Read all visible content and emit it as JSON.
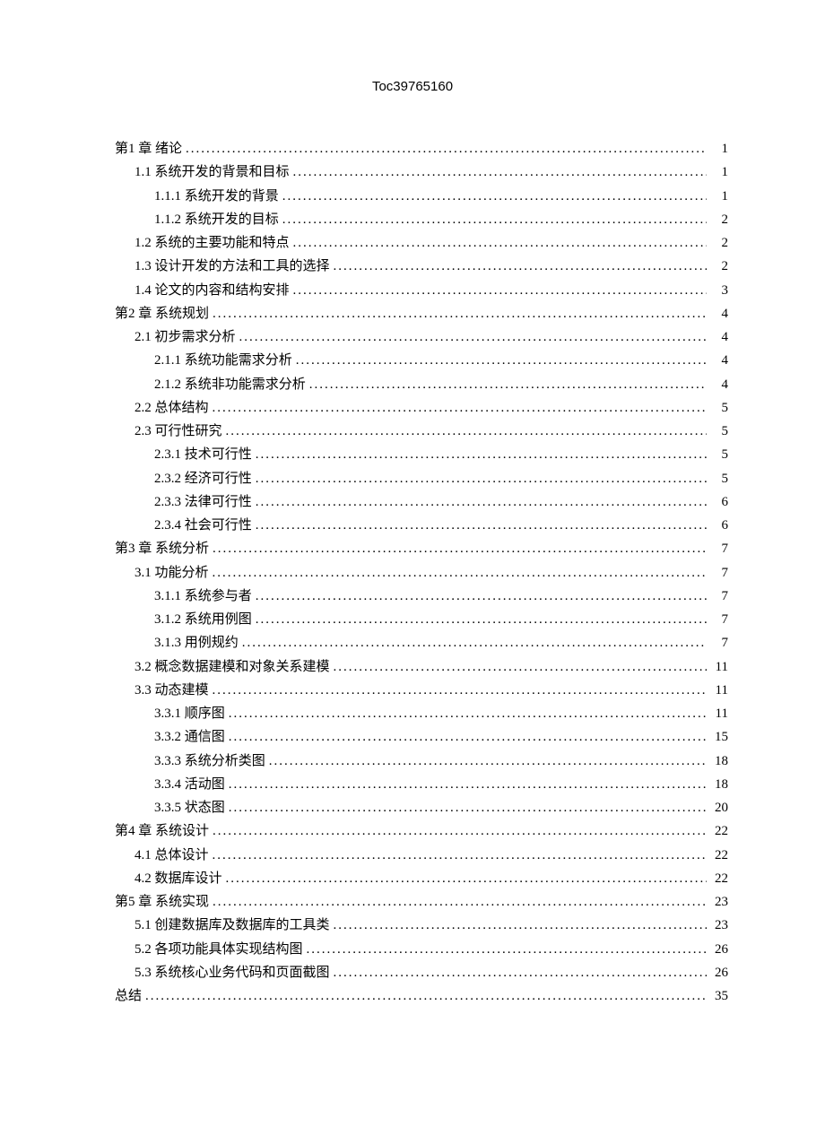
{
  "header": "Toc39765160",
  "toc": [
    {
      "level": 1,
      "label": "第1 章 绪论",
      "page": "1"
    },
    {
      "level": 2,
      "label": "1.1 系统开发的背景和目标",
      "page": " 1"
    },
    {
      "level": 3,
      "label": "1.1.1 系统开发的背景 ",
      "page": "1"
    },
    {
      "level": 3,
      "label": "1.1.2 系统开发的目标 ",
      "page": "2"
    },
    {
      "level": 2,
      "label": "1.2 系统的主要功能和特点 ",
      "page": "2"
    },
    {
      "level": 2,
      "label": "1.3 设计开发的方法和工具的选择 ",
      "page": "2"
    },
    {
      "level": 2,
      "label": "1.4 论文的内容和结构安排 ",
      "page": "3"
    },
    {
      "level": 1,
      "label": "第2 章 系统规划",
      "page": "4"
    },
    {
      "level": 2,
      "label": "2.1 初步需求分析 ",
      "page": "4"
    },
    {
      "level": 3,
      "label": "2.1.1 系统功能需求分析 ",
      "page": "4"
    },
    {
      "level": 3,
      "label": "2.1.2 系统非功能需求分析 ",
      "page": "4"
    },
    {
      "level": 2,
      "label": "2.2 总体结构 ",
      "page": "5"
    },
    {
      "level": 2,
      "label": "2.3 可行性研究 ",
      "page": "5"
    },
    {
      "level": 3,
      "label": "2.3.1 技术可行性 ",
      "page": "5"
    },
    {
      "level": 3,
      "label": "2.3.2 经济可行性 ",
      "page": "5"
    },
    {
      "level": 3,
      "label": "2.3.3 法律可行性",
      "page": "6"
    },
    {
      "level": 3,
      "label": "2.3.4 社会可行性 ",
      "page": "6"
    },
    {
      "level": 1,
      "label": "第3 章 系统分析",
      "page": "7"
    },
    {
      "level": 2,
      "label": "3.1 功能分析 ",
      "page": "7"
    },
    {
      "level": 3,
      "label": "3.1.1 系统参与者 ",
      "page": "7"
    },
    {
      "level": 3,
      "label": "3.1.2 系统用例图 ",
      "page": "7"
    },
    {
      "level": 3,
      "label": "3.1.3 用例规约 ",
      "page": "7"
    },
    {
      "level": 2,
      "label": "3.2 概念数据建模和对象关系建模 ",
      "page": "11"
    },
    {
      "level": 2,
      "label": "3.3 动态建模 ",
      "page": "11"
    },
    {
      "level": 3,
      "label": "3.3.1 顺序图 ",
      "page": "11"
    },
    {
      "level": 3,
      "label": "3.3.2 通信图 ",
      "page": "15"
    },
    {
      "level": 3,
      "label": "3.3.3 系统分析类图 ",
      "page": "18"
    },
    {
      "level": 3,
      "label": "3.3.4 活动图 ",
      "page": "18"
    },
    {
      "level": 3,
      "label": "3.3.5 状态图 ",
      "page": "20"
    },
    {
      "level": 1,
      "label": "第4 章 系统设计",
      "page": "22"
    },
    {
      "level": 2,
      "label": "4.1 总体设计 ",
      "page": "22"
    },
    {
      "level": 2,
      "label": "4.2 数据库设计 ",
      "page": "22"
    },
    {
      "level": 1,
      "label": "第5 章 系统实现",
      "page": "23"
    },
    {
      "level": 2,
      "label": "5.1 创建数据库及数据库的工具类 ",
      "page": "23"
    },
    {
      "level": 2,
      "label": "5.2 各项功能具体实现结构图 ",
      "page": "26"
    },
    {
      "level": 2,
      "label": "5.3 系统核心业务代码和页面截图 ",
      "page": "26"
    },
    {
      "level": 1,
      "label": "总结",
      "page": "35"
    }
  ]
}
